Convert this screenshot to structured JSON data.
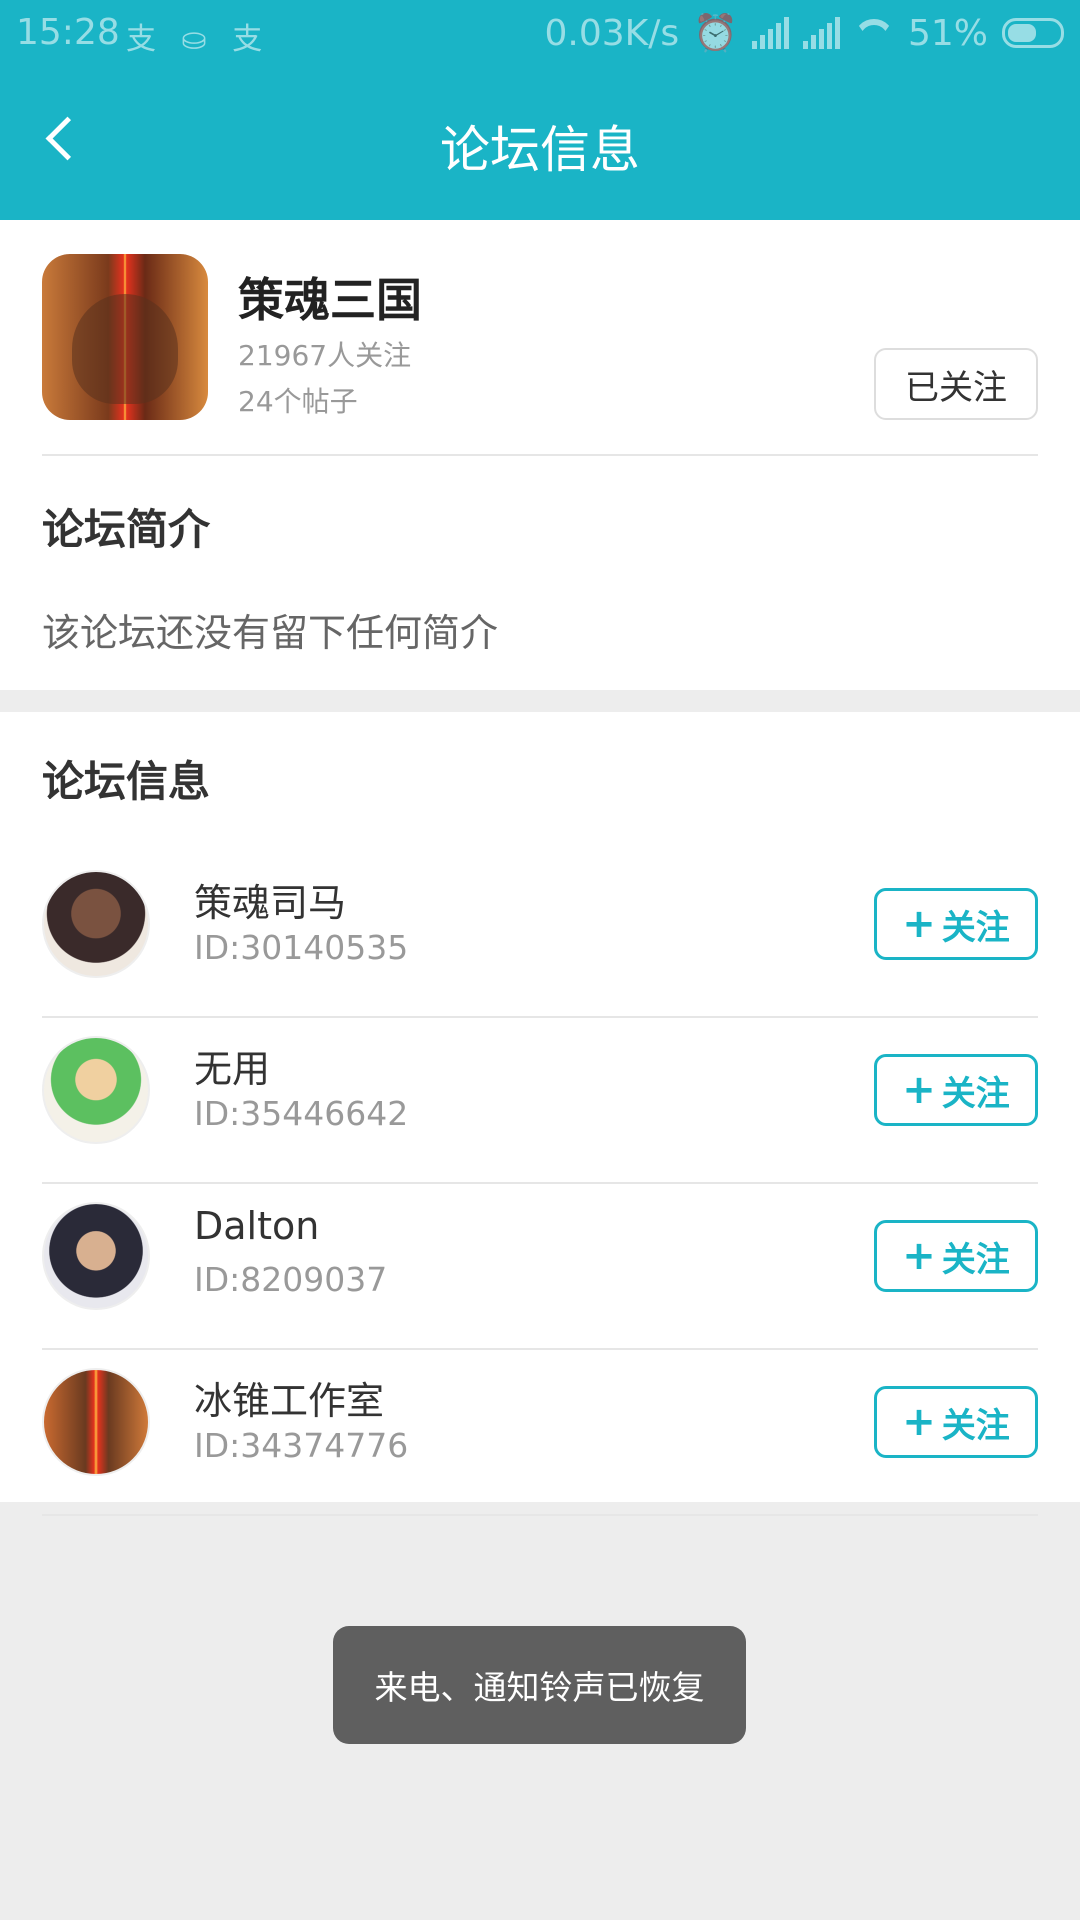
{
  "status_bar": {
    "time": "15:28",
    "notifications": "支 ⛀ 支",
    "speed": "0.03K/s",
    "battery": "51%"
  },
  "app_bar": {
    "title": "论坛信息"
  },
  "forum": {
    "name": "策魂三国",
    "followers": "21967人关注",
    "posts": "24个帖子",
    "follow_state": "已关注"
  },
  "intro": {
    "heading": "论坛简介",
    "text": "该论坛还没有留下任何简介"
  },
  "info": {
    "heading": "论坛信息",
    "members": [
      {
        "name": "策魂司马",
        "id": "ID:30140535",
        "button": "关注"
      },
      {
        "name": "无用",
        "id": "ID:35446642",
        "button": "关注"
      },
      {
        "name": "Dalton",
        "id": "ID:8209037",
        "button": "关注"
      },
      {
        "name": "冰锥工作室",
        "id": "ID:34374776",
        "button": "关注"
      }
    ]
  },
  "toast": {
    "text": "来电、通知铃声已恢复"
  },
  "colors": {
    "accent": "#1ab4c6",
    "background": "#ededed"
  }
}
